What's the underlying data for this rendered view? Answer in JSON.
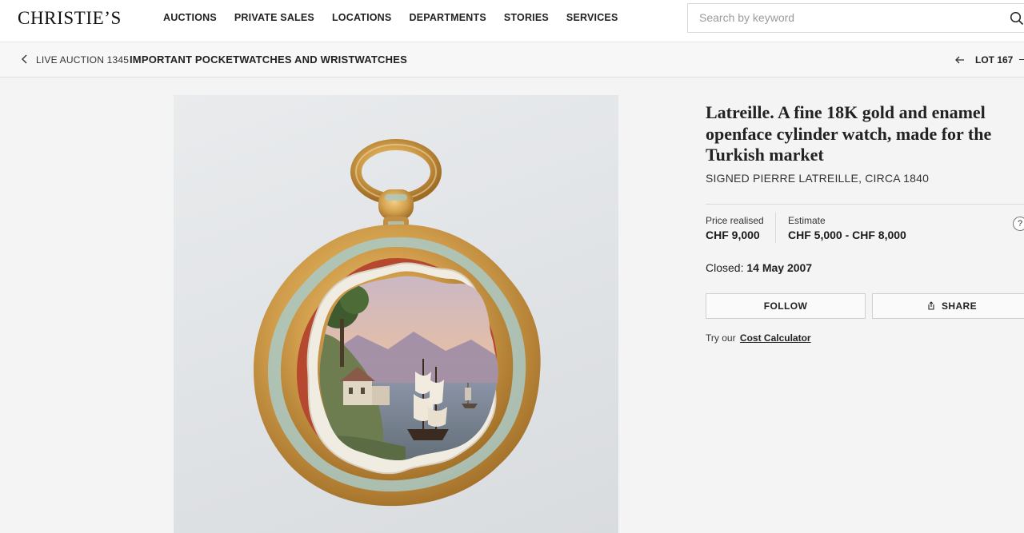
{
  "header": {
    "logo": "CHRISTIE’S",
    "nav": [
      "AUCTIONS",
      "PRIVATE SALES",
      "LOCATIONS",
      "DEPARTMENTS",
      "STORIES",
      "SERVICES"
    ],
    "search_placeholder": "Search by keyword",
    "search_value": ""
  },
  "breadcrumb": {
    "auction_label": "LIVE AUCTION 1345",
    "sale_title": "IMPORTANT POCKETWATCHES AND WRISTWATCHES",
    "lot_label": "LOT 167"
  },
  "lot": {
    "title": "Latreille. A fine 18K gold and enamel openface cylinder watch, made for the Turkish market",
    "subtitle": "SIGNED PIERRE LATREILLE, CIRCA 1840",
    "price_label": "Price realised",
    "price_value": "CHF 9,000",
    "estimate_label": "Estimate",
    "estimate_value": "CHF 5,000 - CHF 8,000",
    "closed_label": "Closed:",
    "closed_value": "14 May 2007",
    "follow_label": "FOLLOW",
    "share_label": "SHARE",
    "help_glyph": "?",
    "try_text": "Try our",
    "calculator_link": "Cost Calculator"
  },
  "icons": {
    "search": "search-icon",
    "back": "chevron-left-icon",
    "lot_prev": "arrow-left-icon",
    "share": "share-icon",
    "help": "question-icon"
  },
  "colors": {
    "gold": "#d3a14e",
    "enamel_blue": "#a9c9c6",
    "enamel_red": "#b5482f",
    "background": "#f4f4f4"
  }
}
